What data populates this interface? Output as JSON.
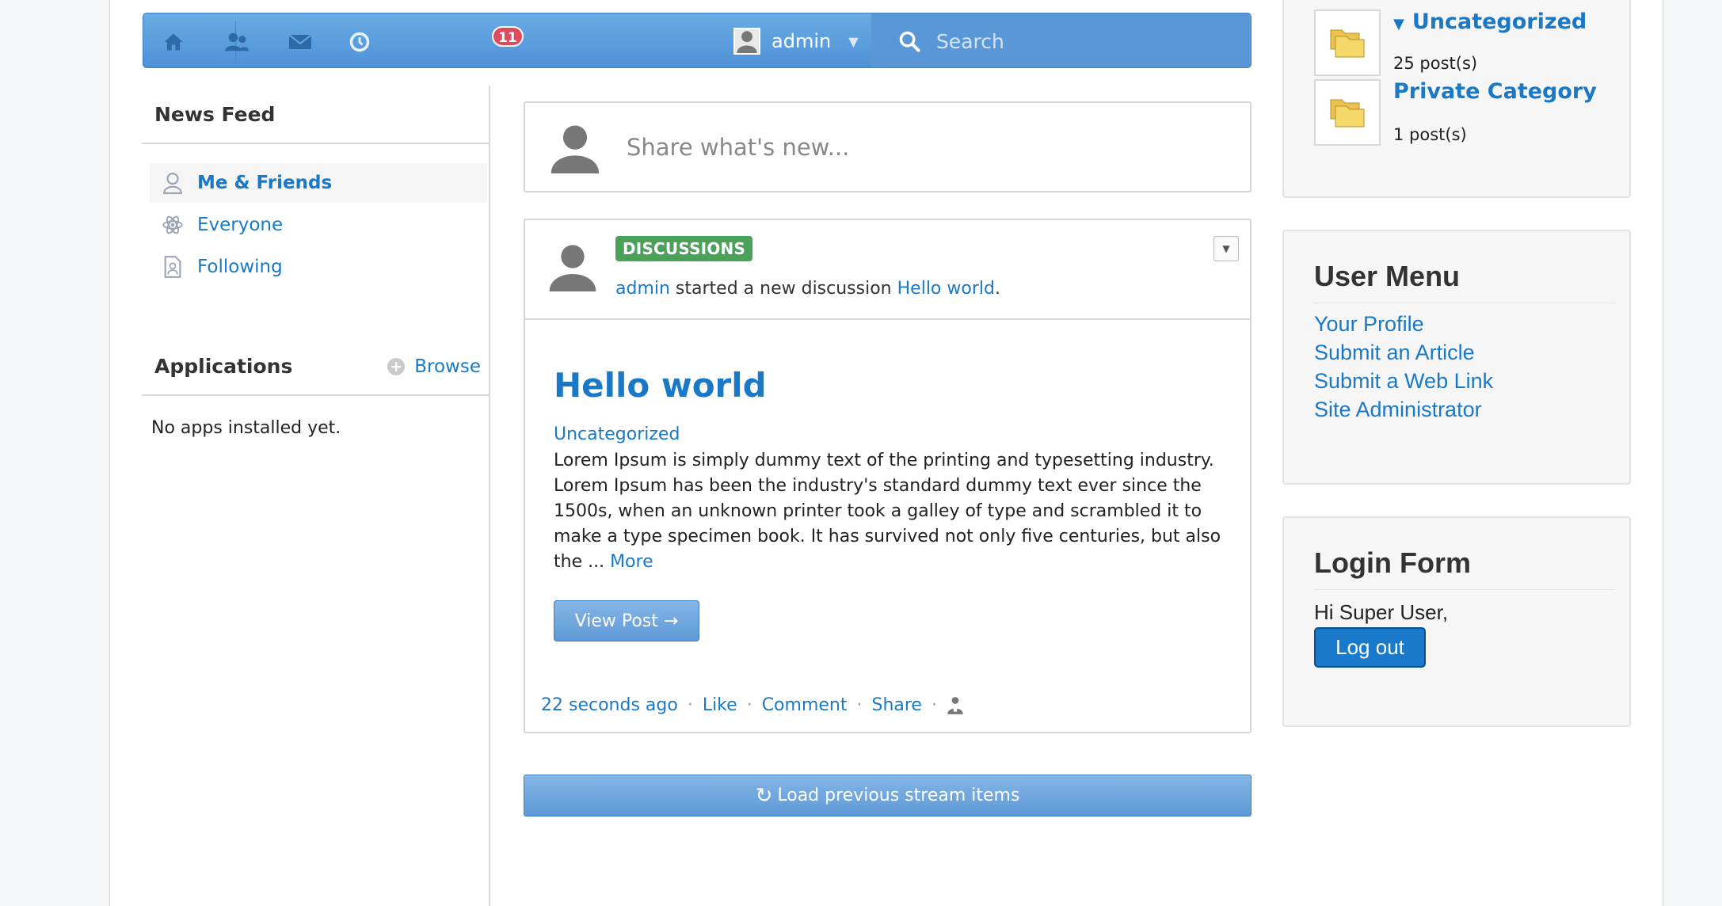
{
  "toolbar": {
    "notification_count": "11",
    "username": "admin",
    "search_placeholder": "Search"
  },
  "left": {
    "news_feed_title": "News Feed",
    "nav_items": [
      {
        "label": "Me & Friends",
        "icon": "user-icon",
        "active": true
      },
      {
        "label": "Everyone",
        "icon": "atom-icon",
        "active": false
      },
      {
        "label": "Following",
        "icon": "document-user-icon",
        "active": false
      }
    ],
    "applications_title": "Applications",
    "browse_label": "Browse",
    "no_apps_text": "No apps installed yet."
  },
  "share": {
    "placeholder": "Share what's new..."
  },
  "stream": {
    "label": "DISCUSSIONS",
    "actor": "admin",
    "action_text": " started a new discussion ",
    "target": "Hello world",
    "period": ".",
    "title": "Hello world",
    "category": "Uncategorized",
    "body": "Lorem Ipsum is simply dummy text of the printing and typesetting industry. Lorem Ipsum has been the industry's standard dummy text ever since the 1500s, when an unknown printer took a galley of type and scrambled it to make a type specimen book. It has survived not only five centuries, but also the ... ",
    "more_label": "More",
    "view_post_label": "View Post →",
    "time": "22 seconds ago",
    "like_label": "Like",
    "comment_label": "Comment",
    "share_label": "Share",
    "separator": "·"
  },
  "load_previous_label": "Load previous stream items",
  "categories": [
    {
      "name": "Uncategorized",
      "count": "25 post(s)",
      "expanded": true
    },
    {
      "name": "Private Category",
      "count": "1 post(s)",
      "expanded": false
    }
  ],
  "user_menu": {
    "title": "User Menu",
    "links": [
      "Your Profile",
      "Submit an Article",
      "Submit a Web Link",
      "Site Administrator"
    ]
  },
  "login_form": {
    "title": "Login Form",
    "greeting": "Hi Super User,",
    "logout_label": "Log out"
  },
  "colors": {
    "link": "#1a79c6",
    "toolbar": "#5a97d7",
    "label_green": "#4aa25a",
    "badge_red": "#e04a5f"
  }
}
